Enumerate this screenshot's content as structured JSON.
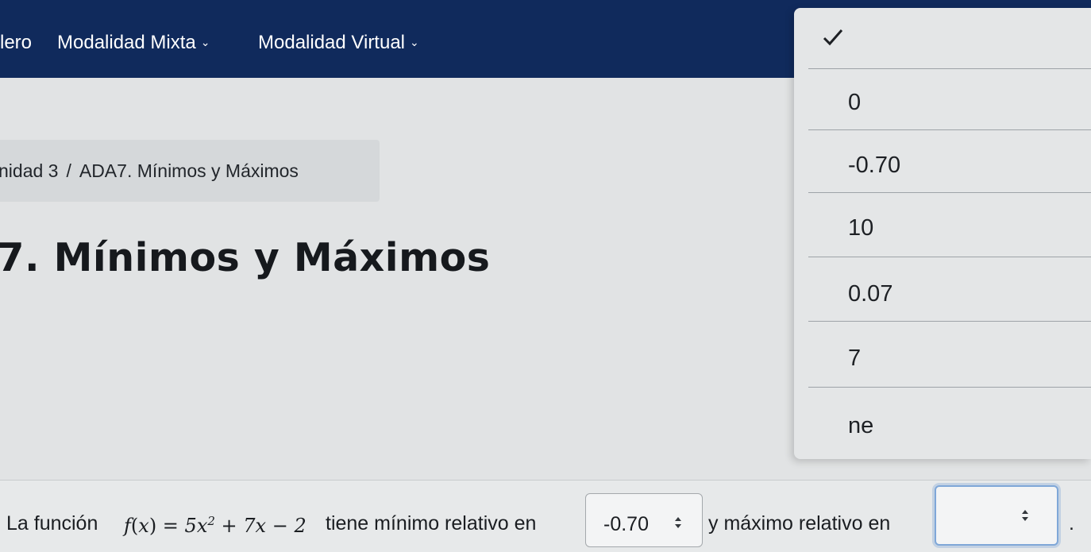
{
  "navbar": {
    "items": [
      {
        "label": "lero"
      },
      {
        "label": "Modalidad Mixta"
      },
      {
        "label": "Modalidad Virtual"
      }
    ]
  },
  "breadcrumb": {
    "parent": "nidad 3",
    "separator": "/",
    "current": "ADA7. Mínimos y Máximos"
  },
  "page": {
    "title": "\\7. Mínimos y Máximos"
  },
  "dropdown": {
    "options": [
      {
        "label": ""
      },
      {
        "label": "0"
      },
      {
        "label": "-0.70"
      },
      {
        "label": "10"
      },
      {
        "label": "0.07"
      },
      {
        "label": "7"
      },
      {
        "label": "ne"
      }
    ]
  },
  "question": {
    "prefix": "La función",
    "func_name": "f",
    "func_var": "x",
    "func_rhs_a": "5x",
    "func_exp": "2",
    "func_rhs_b": "+ 7x − 2",
    "middle": "tiene mínimo relativo en",
    "select1_value": "-0.70",
    "suffix": "y máximo relativo en",
    "select2_value": "",
    "end": "."
  },
  "colors": {
    "navbar_bg": "#102a5c",
    "focus_ring": "#7fa7d8"
  }
}
